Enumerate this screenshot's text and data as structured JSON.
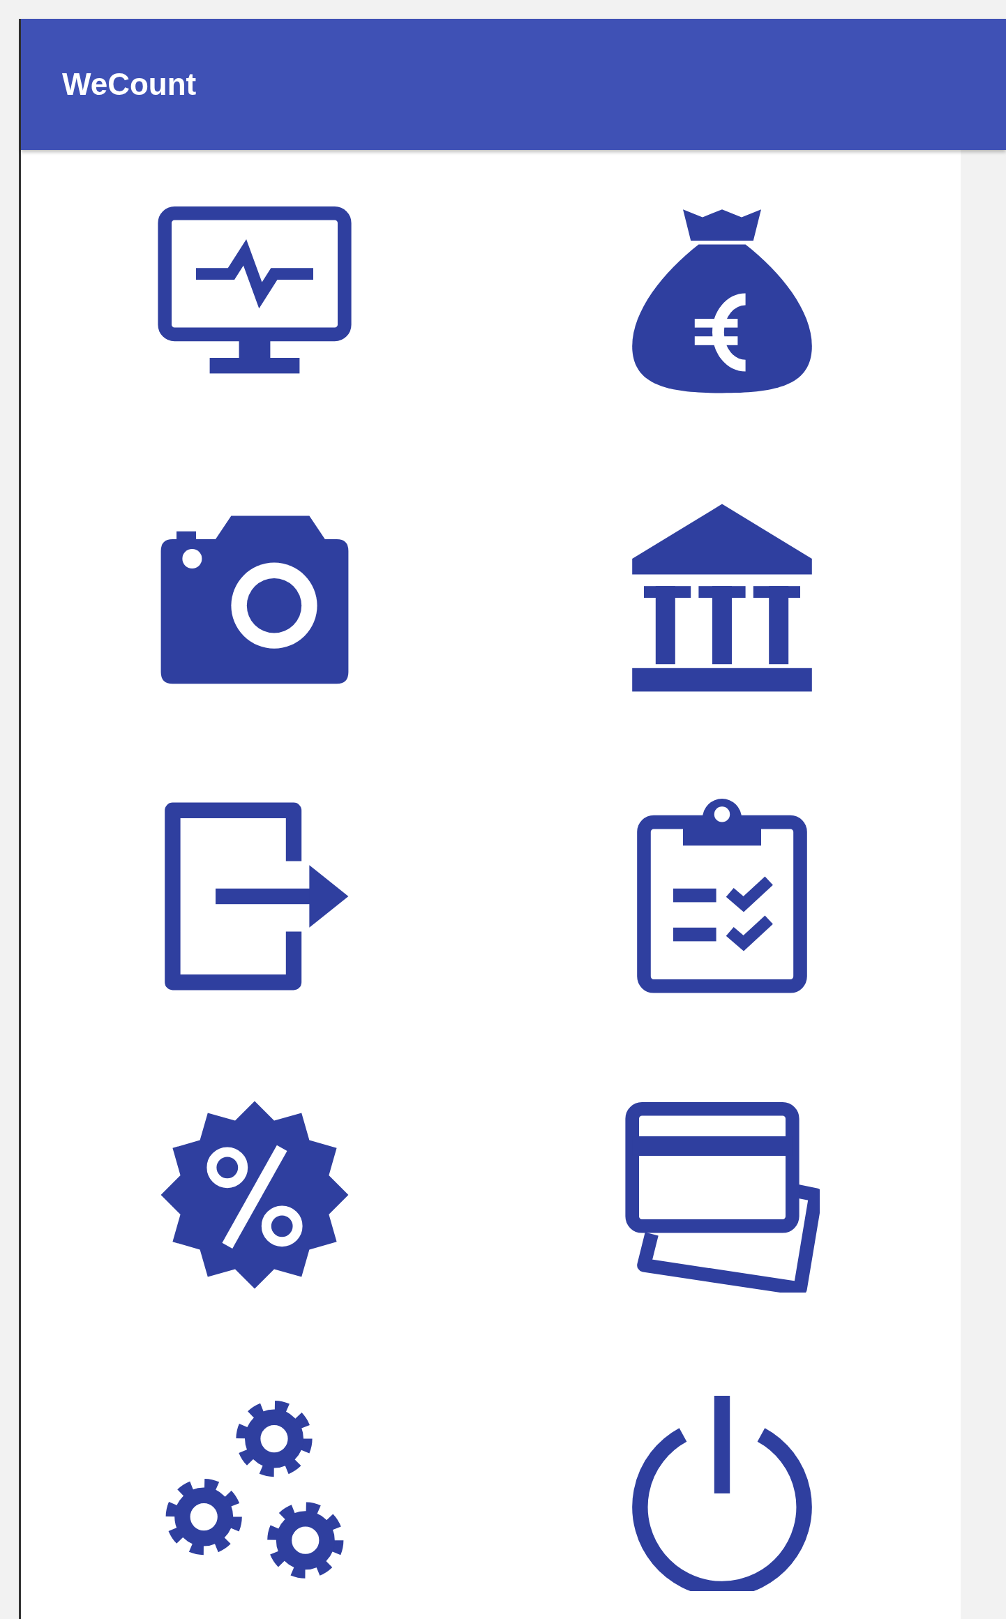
{
  "app_bar": {
    "title": "WeCount"
  },
  "tiles": [
    {
      "kind": "monitor"
    },
    {
      "kind": "moneybag"
    },
    {
      "kind": "camera"
    },
    {
      "kind": "bank"
    },
    {
      "kind": "exit"
    },
    {
      "kind": "clipboard"
    },
    {
      "kind": "percent"
    },
    {
      "kind": "cards"
    },
    {
      "kind": "gears"
    },
    {
      "kind": "power"
    }
  ]
}
